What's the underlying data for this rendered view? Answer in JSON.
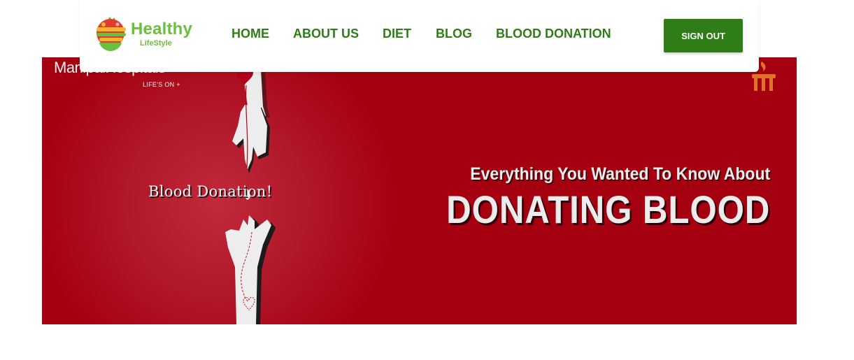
{
  "brand": {
    "name_line1": "Healthy",
    "name_line2": "LifeStyle",
    "primary_color": "#2e7d16",
    "logo_green": "#6bbf3e"
  },
  "nav": {
    "items": [
      {
        "label": "HOME"
      },
      {
        "label": "ABOUT US"
      },
      {
        "label": "DIET"
      },
      {
        "label": "BLOG"
      },
      {
        "label": "BLOOD DONATION"
      }
    ],
    "signout_label": "SIGN OUT"
  },
  "banner": {
    "hospital_name": "ManipalHospitals",
    "hospital_tagline": "LIFE'S ON +",
    "donation_text": "Blood Donation!",
    "headline_small": "Everything You Wanted To Know About",
    "headline_big": "DONATING BLOOD",
    "background_color": "#a4000f"
  }
}
